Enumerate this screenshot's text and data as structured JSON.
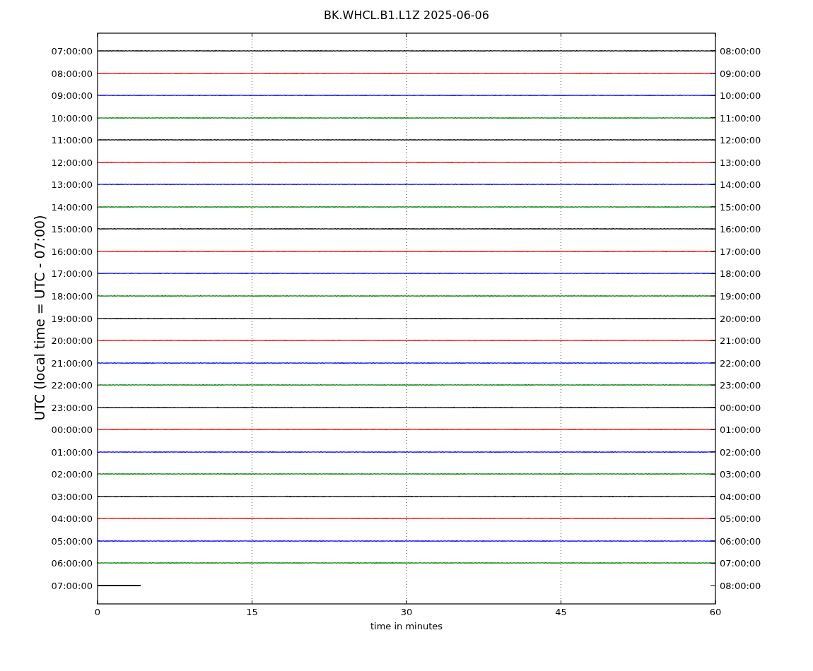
{
  "title": "BK.WHCL.B1.L1Z 2025-06-06",
  "ylabel": "UTC (local time = UTC - 07:00)",
  "xlabel": "time in minutes",
  "xticks": [
    "0",
    "15",
    "30",
    "45",
    "60"
  ],
  "traces": [
    {
      "left": "07:00:00",
      "right": "08:00:00",
      "color": "#000000",
      "kind": "full"
    },
    {
      "left": "08:00:00",
      "right": "09:00:00",
      "color": "#ff0000",
      "kind": "full"
    },
    {
      "left": "09:00:00",
      "right": "10:00:00",
      "color": "#0000ff",
      "kind": "full"
    },
    {
      "left": "10:00:00",
      "right": "11:00:00",
      "color": "#008000",
      "kind": "full"
    },
    {
      "left": "11:00:00",
      "right": "12:00:00",
      "color": "#000000",
      "kind": "full"
    },
    {
      "left": "12:00:00",
      "right": "13:00:00",
      "color": "#ff0000",
      "kind": "full"
    },
    {
      "left": "13:00:00",
      "right": "14:00:00",
      "color": "#0000ff",
      "kind": "full"
    },
    {
      "left": "14:00:00",
      "right": "15:00:00",
      "color": "#008000",
      "kind": "full"
    },
    {
      "left": "15:00:00",
      "right": "16:00:00",
      "color": "#000000",
      "kind": "full"
    },
    {
      "left": "16:00:00",
      "right": "17:00:00",
      "color": "#ff0000",
      "kind": "full"
    },
    {
      "left": "17:00:00",
      "right": "18:00:00",
      "color": "#0000ff",
      "kind": "full"
    },
    {
      "left": "18:00:00",
      "right": "19:00:00",
      "color": "#008000",
      "kind": "full"
    },
    {
      "left": "19:00:00",
      "right": "20:00:00",
      "color": "#000000",
      "kind": "full"
    },
    {
      "left": "20:00:00",
      "right": "21:00:00",
      "color": "#ff0000",
      "kind": "full"
    },
    {
      "left": "21:00:00",
      "right": "22:00:00",
      "color": "#0000ff",
      "kind": "full"
    },
    {
      "left": "22:00:00",
      "right": "23:00:00",
      "color": "#008000",
      "kind": "full"
    },
    {
      "left": "23:00:00",
      "right": "00:00:00",
      "color": "#000000",
      "kind": "full"
    },
    {
      "left": "00:00:00",
      "right": "01:00:00",
      "color": "#ff0000",
      "kind": "full"
    },
    {
      "left": "01:00:00",
      "right": "02:00:00",
      "color": "#0000ff",
      "kind": "full"
    },
    {
      "left": "02:00:00",
      "right": "03:00:00",
      "color": "#008000",
      "kind": "full"
    },
    {
      "left": "03:00:00",
      "right": "04:00:00",
      "color": "#000000",
      "kind": "full"
    },
    {
      "left": "04:00:00",
      "right": "05:00:00",
      "color": "#ff0000",
      "kind": "full"
    },
    {
      "left": "05:00:00",
      "right": "06:00:00",
      "color": "#0000ff",
      "kind": "full"
    },
    {
      "left": "06:00:00",
      "right": "07:00:00",
      "color": "#008000",
      "kind": "full"
    },
    {
      "left": "07:00:00",
      "right": "08:00:00",
      "color": "#000000",
      "kind": "partial"
    }
  ]
}
